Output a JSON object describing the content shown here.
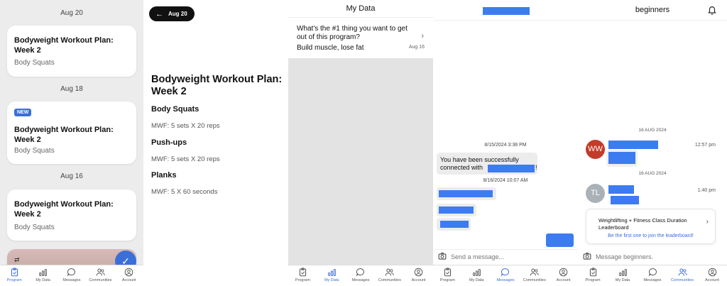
{
  "colors": {
    "accent": "#3b6fd8",
    "redaction": "#3d7cf0",
    "badge": "#3b6fd8"
  },
  "tabs": [
    "Program",
    "My Data",
    "Messages",
    "Communities",
    "Account"
  ],
  "panel1": {
    "groups": [
      {
        "date": "Aug 20",
        "title": "Bodyweight Workout Plan: Week 2",
        "subtitle": "Body Squats",
        "badge": ""
      },
      {
        "date": "Aug 18",
        "title": "Bodyweight Workout Plan: Week 2",
        "subtitle": "Body Squats",
        "badge": "NEW"
      },
      {
        "date": "Aug 16",
        "title": "Bodyweight Workout Plan: Week 2",
        "subtitle": "Body Squats",
        "badge": ""
      }
    ],
    "active_tab": "Program"
  },
  "panel2": {
    "back_pill": "Aug 20",
    "title": "Bodyweight Workout Plan: Week 2",
    "exercises": [
      {
        "name": "Body Squats",
        "detail": "MWF: 5 sets X 20 reps"
      },
      {
        "name": "Push-ups",
        "detail": "MWF: 5 sets X 20 reps"
      },
      {
        "name": "Planks",
        "detail": "MWF: 5 X 60 seconds"
      }
    ]
  },
  "panel3": {
    "header": "My Data",
    "question": "What's the #1 thing you want to get out of this program?",
    "answer": "Build muscle, lose fat",
    "date": "Aug 16",
    "active_tab": "My Data"
  },
  "panel4": {
    "timestamp1": "8/15/2024 3:38 PM",
    "message1": "You have been successfully connected with",
    "message1_end": "!",
    "timestamp2": "8/16/2024 10:07 AM",
    "input_placeholder": "Send a message...",
    "active_tab": "Messages"
  },
  "panel5": {
    "title": "beginners",
    "date1": "16 AUG 2024",
    "avatar1": "WW",
    "time1": "12:57 pm",
    "date2": "16 AUG 2024",
    "avatar2": "TL",
    "time2": "1:40 pm",
    "leaderboard_title": "Weightlifting + Fitness Class Duration Leaderboard",
    "leaderboard_cta": "Be the first one to join the leaderboard!",
    "input_placeholder": "Message beginners.",
    "active_tab": "Communities"
  }
}
